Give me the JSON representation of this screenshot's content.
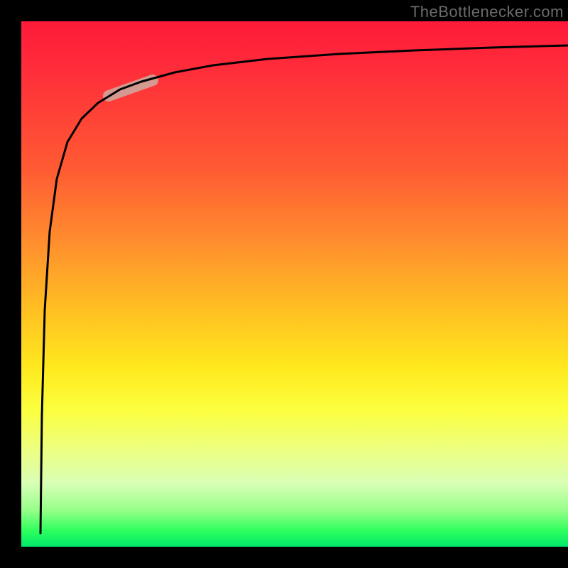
{
  "watermark": "TheBottlenecker.com",
  "colors": {
    "curve": "#000000",
    "highlight": "#d49a91",
    "gradient_top": "#ff1a3a",
    "gradient_bottom": "#00e86b"
  },
  "chart_data": {
    "type": "line",
    "title": "",
    "xlabel": "",
    "ylabel": "",
    "xlim": [
      0,
      100
    ],
    "ylim": [
      0,
      100
    ],
    "grid": false,
    "legend": false,
    "note": "Axes have no visible tick labels in source; x/y in 0–100 plot-fraction units (0,0 = bottom-left).",
    "series": [
      {
        "name": "curve",
        "x": [
          3.5,
          3.8,
          4.3,
          5.2,
          6.5,
          8.5,
          11.0,
          14.0,
          18.0,
          22.0,
          28.0,
          35.0,
          45.0,
          58.0,
          72.0,
          86.0,
          100.0
        ],
        "y": [
          2.5,
          25.0,
          45.0,
          60.0,
          70.0,
          77.0,
          81.5,
          84.5,
          87.0,
          88.5,
          90.3,
          91.6,
          92.8,
          93.8,
          94.5,
          95.0,
          95.4
        ]
      },
      {
        "name": "highlight_segment",
        "x": [
          16.0,
          24.0
        ],
        "y": [
          85.8,
          88.8
        ]
      }
    ]
  }
}
